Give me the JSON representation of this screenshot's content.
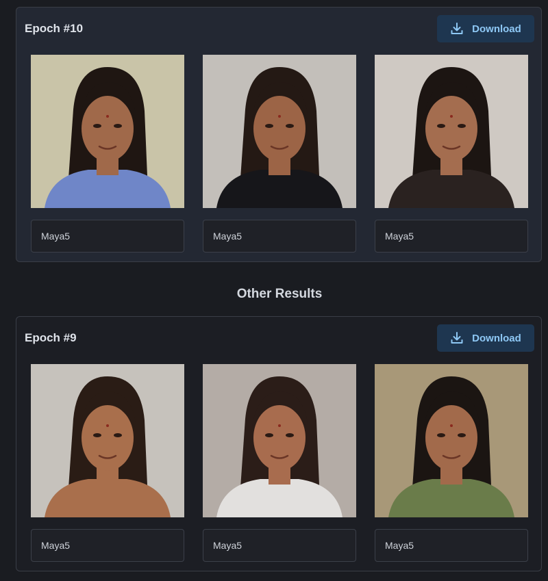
{
  "sections": [
    {
      "title": "Epoch #10",
      "download_label": "Download",
      "images": [
        {
          "caption": "Maya5",
          "bg": "#c9c4a8",
          "skin": "#a0694a",
          "hair": "#1f1612",
          "top": "#6f86c8"
        },
        {
          "caption": "Maya5",
          "bg": "#c3bfba",
          "skin": "#9c6446",
          "hair": "#241914",
          "top": "#16161a"
        },
        {
          "caption": "Maya5",
          "bg": "#cfc9c3",
          "skin": "#a46d4f",
          "hair": "#1c1512",
          "top": "#2a2220"
        }
      ]
    },
    {
      "title": "Epoch #9",
      "download_label": "Download",
      "images": [
        {
          "caption": "Maya5",
          "bg": "#c6c2bc",
          "skin": "#a96f4c",
          "hair": "#2a1c15",
          "top": "#a96f4c"
        },
        {
          "caption": "Maya5",
          "bg": "#b4aca6",
          "skin": "#a86c4e",
          "hair": "#2b1d18",
          "top": "#e2e0de"
        },
        {
          "caption": "Maya5",
          "bg": "#a89878",
          "skin": "#a26a4b",
          "hair": "#1b1512",
          "top": "#6a7c4a"
        }
      ]
    }
  ],
  "other_results_title": "Other Results",
  "colors": {
    "accent": "#8ec8f5",
    "button_bg": "#1e3650",
    "page_bg": "#1a1c21"
  }
}
